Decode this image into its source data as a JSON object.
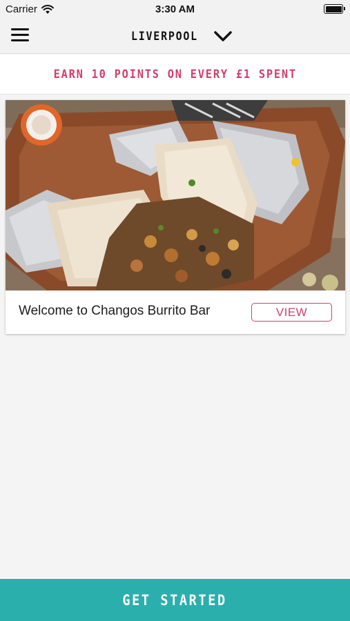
{
  "status_bar": {
    "carrier": "Carrier",
    "time": "3:30 AM",
    "icons": [
      "wifi-icon",
      "battery-icon"
    ]
  },
  "nav": {
    "title": "LIVERPOOL",
    "icons": [
      "menu-icon",
      "chevron-down-icon"
    ]
  },
  "promo": {
    "text": "EARN 10 POINTS ON EVERY £1 SPENT",
    "color": "#d23d6c"
  },
  "card": {
    "title": "Welcome to Changos Burrito Bar",
    "button_label": "VIEW"
  },
  "cta": {
    "label": "GET STARTED",
    "color": "#2aafad"
  }
}
